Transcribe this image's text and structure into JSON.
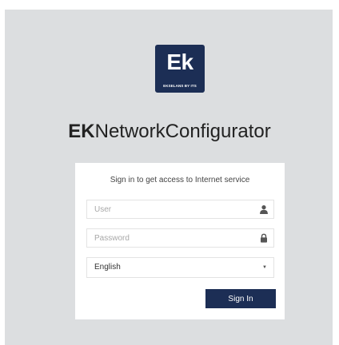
{
  "brand": {
    "logo_text": "Ek",
    "logo_tagline": "EKSELANS BY ITS",
    "title_bold": "EK",
    "title_rest": "NetworkConfigurator"
  },
  "login": {
    "subtitle": "Sign in to get access to Internet service",
    "user_placeholder": "User",
    "password_placeholder": "Password",
    "language_value": "English",
    "signin_label": "Sign In"
  },
  "icons": {
    "user": "user-icon",
    "password": "lock-icon",
    "dropdown": "caret-down-icon"
  },
  "colors": {
    "brand": "#1c2e55",
    "background": "#dcdee0"
  }
}
